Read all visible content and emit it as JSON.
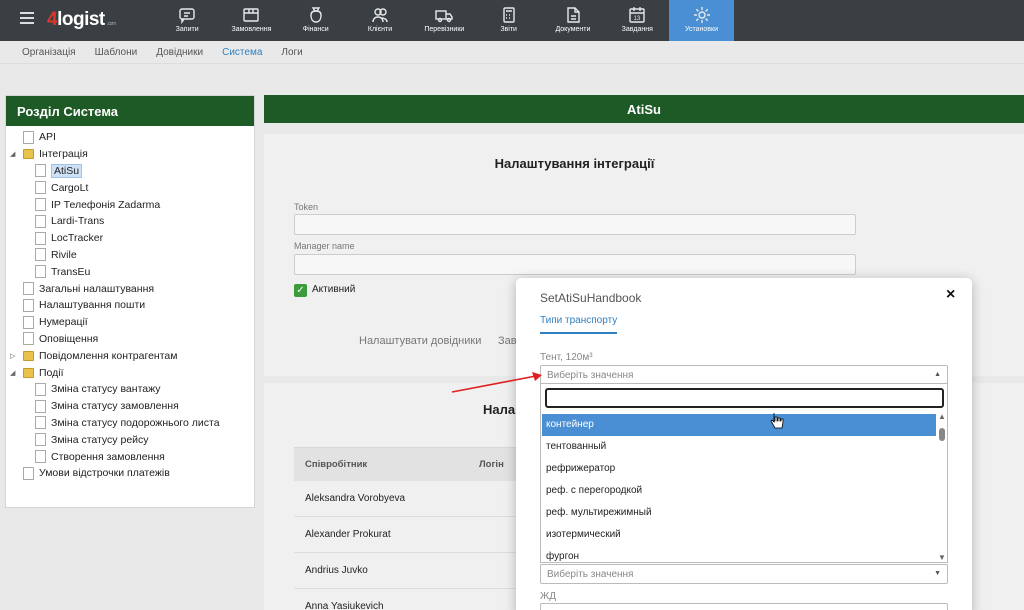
{
  "brand": {
    "prefix": "4",
    "name": "logist",
    "suffix": ".com"
  },
  "nav": [
    {
      "label": "Запити",
      "icon": "chat-icon"
    },
    {
      "label": "Замовлення",
      "icon": "box-icon"
    },
    {
      "label": "Фінанси",
      "icon": "money-bag-icon"
    },
    {
      "label": "Клієнти",
      "icon": "users-icon"
    },
    {
      "label": "Перевізники",
      "icon": "truck-icon"
    },
    {
      "label": "Звіти",
      "icon": "calculator-icon"
    },
    {
      "label": "Документи",
      "icon": "document-icon"
    },
    {
      "label": "Завдання",
      "icon": "calendar-icon"
    },
    {
      "label": "Установки",
      "icon": "gear-icon",
      "active": true
    }
  ],
  "subnav": [
    "Організація",
    "Шаблони",
    "Довідники",
    "Система",
    "Логи"
  ],
  "left": {
    "title": "Розділ Система",
    "tree": [
      {
        "label": "API",
        "kind": "doc",
        "level": 0
      },
      {
        "label": "Інтеграція",
        "kind": "folder",
        "level": 0,
        "expanded": true
      },
      {
        "label": "AtiSu",
        "kind": "doc",
        "level": 1,
        "selected": true
      },
      {
        "label": "CargoLt",
        "kind": "doc",
        "level": 1
      },
      {
        "label": "IP Телефонія Zadarma",
        "kind": "doc",
        "level": 1
      },
      {
        "label": "Lardi-Trans",
        "kind": "doc",
        "level": 1
      },
      {
        "label": "LocTracker",
        "kind": "doc",
        "level": 1
      },
      {
        "label": "Rivile",
        "kind": "doc",
        "level": 1
      },
      {
        "label": "TransEu",
        "kind": "doc",
        "level": 1
      },
      {
        "label": "Загальні налаштування",
        "kind": "doc",
        "level": 0
      },
      {
        "label": "Налаштування пошти",
        "kind": "doc",
        "level": 0
      },
      {
        "label": "Нумерації",
        "kind": "doc",
        "level": 0
      },
      {
        "label": "Оповіщення",
        "kind": "doc",
        "level": 0
      },
      {
        "label": "Повідомлення контрагентам",
        "kind": "folder",
        "level": 0,
        "expanded": false
      },
      {
        "label": "Події",
        "kind": "folder",
        "level": 0,
        "expanded": true
      },
      {
        "label": "Зміна статусу вантажу",
        "kind": "doc",
        "level": 1
      },
      {
        "label": "Зміна статусу замовлення",
        "kind": "doc",
        "level": 1
      },
      {
        "label": "Зміна статусу подорожнього листа",
        "kind": "doc",
        "level": 1
      },
      {
        "label": "Зміна статусу рейсу",
        "kind": "doc",
        "level": 1
      },
      {
        "label": "Створення замовлення",
        "kind": "doc",
        "level": 1
      },
      {
        "label": "Умови відстрочки платежів",
        "kind": "doc",
        "level": 0
      }
    ]
  },
  "right": {
    "title": "AtiSu",
    "card_title": "Налаштування інтеграції",
    "token_label": "Token",
    "manager_label": "Manager name",
    "active_label": "Активний",
    "link_handbook": "Налаштувати довідники",
    "link_cut": "Зав",
    "card2_title": "Нала",
    "table_headers": [
      "Співробітник",
      "Логін"
    ],
    "employees": [
      "Aleksandra Vorobyeva",
      "Alexander Prokurat",
      "Andrius Juvko",
      "Anna Yasiukevich"
    ]
  },
  "modal": {
    "title": "SetAtiSuHandbook",
    "close": "×",
    "tab": "Типи транспорту",
    "field1_label": "Тент, 120м³",
    "placeholder": "Виберіть значення",
    "options": [
      "контейнер",
      "тентованный",
      "рефрижератор",
      "реф. с перегородкой",
      "реф. мультирежимный",
      "изотермический",
      "фургон"
    ],
    "highlighted": "контейнер",
    "field3_label": "ЖД"
  },
  "colors": {
    "nav_bg": "#3a3f44",
    "nav_active": "#4a8fd3",
    "header_green": "#1e5a25",
    "link_blue": "#2f7fc1",
    "arrow_red": "#e02020"
  }
}
